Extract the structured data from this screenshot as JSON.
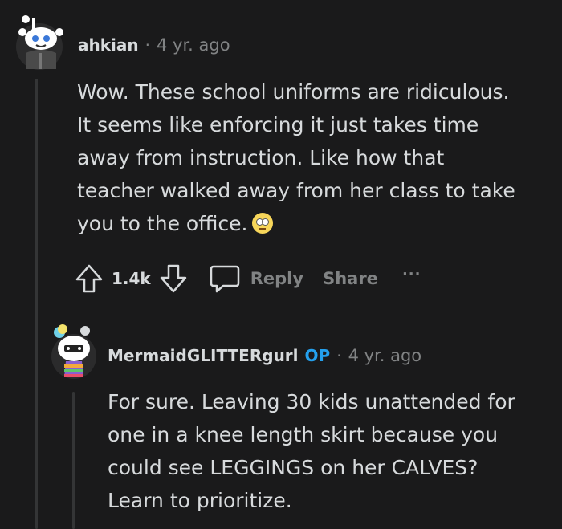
{
  "comments": [
    {
      "username": "ahkian",
      "separator": "·",
      "time": "4 yr. ago",
      "lines": [
        "Wow. These school uniforms are ridiculous.",
        "It seems like enforcing it just takes time",
        "away from instruction. Like how that",
        "teacher walked away from her class to take",
        "you to the office."
      ],
      "emoji": "face-with-rolling-eyes",
      "votes": "1.4k",
      "reply_label": "Reply",
      "share_label": "Share",
      "more_label": "···"
    },
    {
      "username": "MermaidGLITTERgurl",
      "op_badge": "OP",
      "separator": "·",
      "time": "4 yr. ago",
      "lines": [
        "For sure. Leaving 30 kids unattended for",
        "one in a knee length skirt because you",
        "could see LEGGINGS on her CALVES?",
        "Learn to prioritize."
      ]
    }
  ],
  "colors": {
    "background": "#1a1a1b",
    "text": "#d7dadc",
    "muted": "#818384",
    "op": "#24a0ed",
    "thread_line": "#343536"
  }
}
